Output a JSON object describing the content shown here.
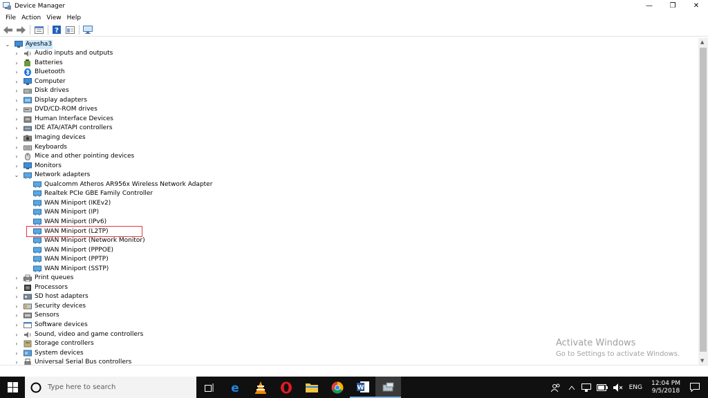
{
  "window": {
    "title": "Device Manager",
    "controls": {
      "minimize": "—",
      "restore": "❐",
      "close": "✕"
    }
  },
  "menu": [
    "File",
    "Action",
    "View",
    "Help"
  ],
  "toolbar": [
    "back-icon",
    "forward-icon",
    "properties-icon",
    "help-icon",
    "view-icon",
    "monitor-icon"
  ],
  "tree": {
    "root": "Ayesha3",
    "categories": [
      {
        "label": "Audio inputs and outputs",
        "icon": "speaker-icon"
      },
      {
        "label": "Batteries",
        "icon": "battery-icon"
      },
      {
        "label": "Bluetooth",
        "icon": "bluetooth-icon"
      },
      {
        "label": "Computer",
        "icon": "computer-icon"
      },
      {
        "label": "Disk drives",
        "icon": "disk-icon"
      },
      {
        "label": "Display adapters",
        "icon": "display-icon"
      },
      {
        "label": "DVD/CD-ROM drives",
        "icon": "dvd-icon"
      },
      {
        "label": "Human Interface Devices",
        "icon": "hid-icon"
      },
      {
        "label": "IDE ATA/ATAPI controllers",
        "icon": "ide-icon"
      },
      {
        "label": "Imaging devices",
        "icon": "camera-icon"
      },
      {
        "label": "Keyboards",
        "icon": "keyboard-icon"
      },
      {
        "label": "Mice and other pointing devices",
        "icon": "mouse-icon"
      },
      {
        "label": "Monitors",
        "icon": "monitor-icon"
      },
      {
        "label": "Network adapters",
        "icon": "network-icon",
        "expanded": true,
        "children": [
          "Qualcomm Atheros AR956x Wireless Network Adapter",
          "Realtek PCIe GBE Family Controller",
          "WAN Miniport (IKEv2)",
          "WAN Miniport (IP)",
          "WAN Miniport (IPv6)",
          "WAN Miniport (L2TP)",
          "WAN Miniport (Network Monitor)",
          "WAN Miniport (PPPOE)",
          "WAN Miniport (PPTP)",
          "WAN Miniport (SSTP)"
        ]
      },
      {
        "label": "Print queues",
        "icon": "printer-icon"
      },
      {
        "label": "Processors",
        "icon": "processor-icon"
      },
      {
        "label": "SD host adapters",
        "icon": "sd-icon"
      },
      {
        "label": "Security devices",
        "icon": "security-icon"
      },
      {
        "label": "Sensors",
        "icon": "sensor-icon"
      },
      {
        "label": "Software devices",
        "icon": "software-icon"
      },
      {
        "label": "Sound, video and game controllers",
        "icon": "sound-icon"
      },
      {
        "label": "Storage controllers",
        "icon": "storage-icon"
      },
      {
        "label": "System devices",
        "icon": "system-icon"
      },
      {
        "label": "Universal Serial Bus controllers",
        "icon": "usb-icon"
      }
    ],
    "highlighted_child": "Realtek PCIe GBE Family Controller"
  },
  "watermark": {
    "line1": "Activate Windows",
    "line2": "Go to Settings to activate Windows."
  },
  "taskbar": {
    "search_placeholder": "Type here to search",
    "apps": [
      "task-view-icon",
      "edge-icon",
      "vlc-icon",
      "opera-icon",
      "file-explorer-icon",
      "chrome-icon",
      "word-icon",
      "device-manager-icon"
    ],
    "tray": {
      "lang": "ENG",
      "time": "12:04 PM",
      "date": "9/5/2018"
    }
  },
  "colors": {
    "selection": "#cce8ff",
    "highlight_border": "#e0393e",
    "taskbar": "#101010"
  }
}
